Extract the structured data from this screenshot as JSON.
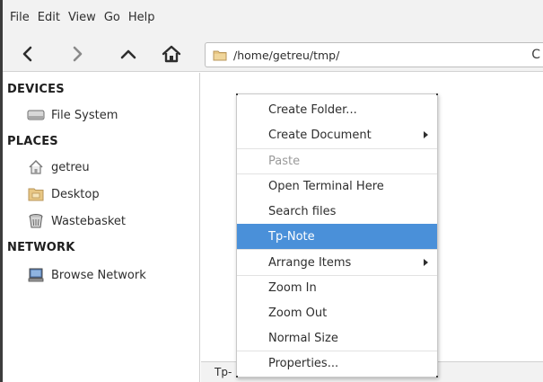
{
  "menubar": {
    "items": [
      "File",
      "Edit",
      "View",
      "Go",
      "Help"
    ]
  },
  "toolbar": {
    "back_icon": "chevron-left-icon",
    "forward_icon": "chevron-right-icon",
    "up_icon": "chevron-up-icon",
    "home_icon": "home-icon",
    "location": "/home/getreu/tmp/",
    "reload_icon": "reload-icon",
    "reload_glyph": "C"
  },
  "sidebar": {
    "devices_heading": "DEVICES",
    "devices": [
      {
        "label": "File System",
        "icon": "drive-icon"
      }
    ],
    "places_heading": "PLACES",
    "places": [
      {
        "label": "getreu",
        "icon": "home-folder-icon"
      },
      {
        "label": "Desktop",
        "icon": "desktop-folder-icon"
      },
      {
        "label": "Wastebasket",
        "icon": "trash-icon"
      }
    ],
    "network_heading": "NETWORK",
    "network": [
      {
        "label": "Browse Network",
        "icon": "network-icon"
      }
    ]
  },
  "statusbar": {
    "text": "Tp-"
  },
  "context_menu": {
    "items": [
      {
        "label": "Create Folder...",
        "state": "normal",
        "submenu": false
      },
      {
        "label": "Create Document",
        "state": "normal",
        "submenu": true
      },
      {
        "label": "Paste",
        "state": "disabled",
        "submenu": false
      },
      {
        "label": "Open Terminal Here",
        "state": "normal",
        "submenu": false
      },
      {
        "label": "Search files",
        "state": "normal",
        "submenu": false
      },
      {
        "label": "Tp-Note",
        "state": "highlighted",
        "submenu": false
      },
      {
        "label": "Arrange Items",
        "state": "normal",
        "submenu": true
      },
      {
        "label": "Zoom In",
        "state": "normal",
        "submenu": false
      },
      {
        "label": "Zoom Out",
        "state": "normal",
        "submenu": false
      },
      {
        "label": "Normal Size",
        "state": "normal",
        "submenu": false
      },
      {
        "label": "Properties...",
        "state": "normal",
        "submenu": false
      }
    ]
  },
  "colors": {
    "highlight": "#4a90d9",
    "folder": "#e8c784"
  }
}
